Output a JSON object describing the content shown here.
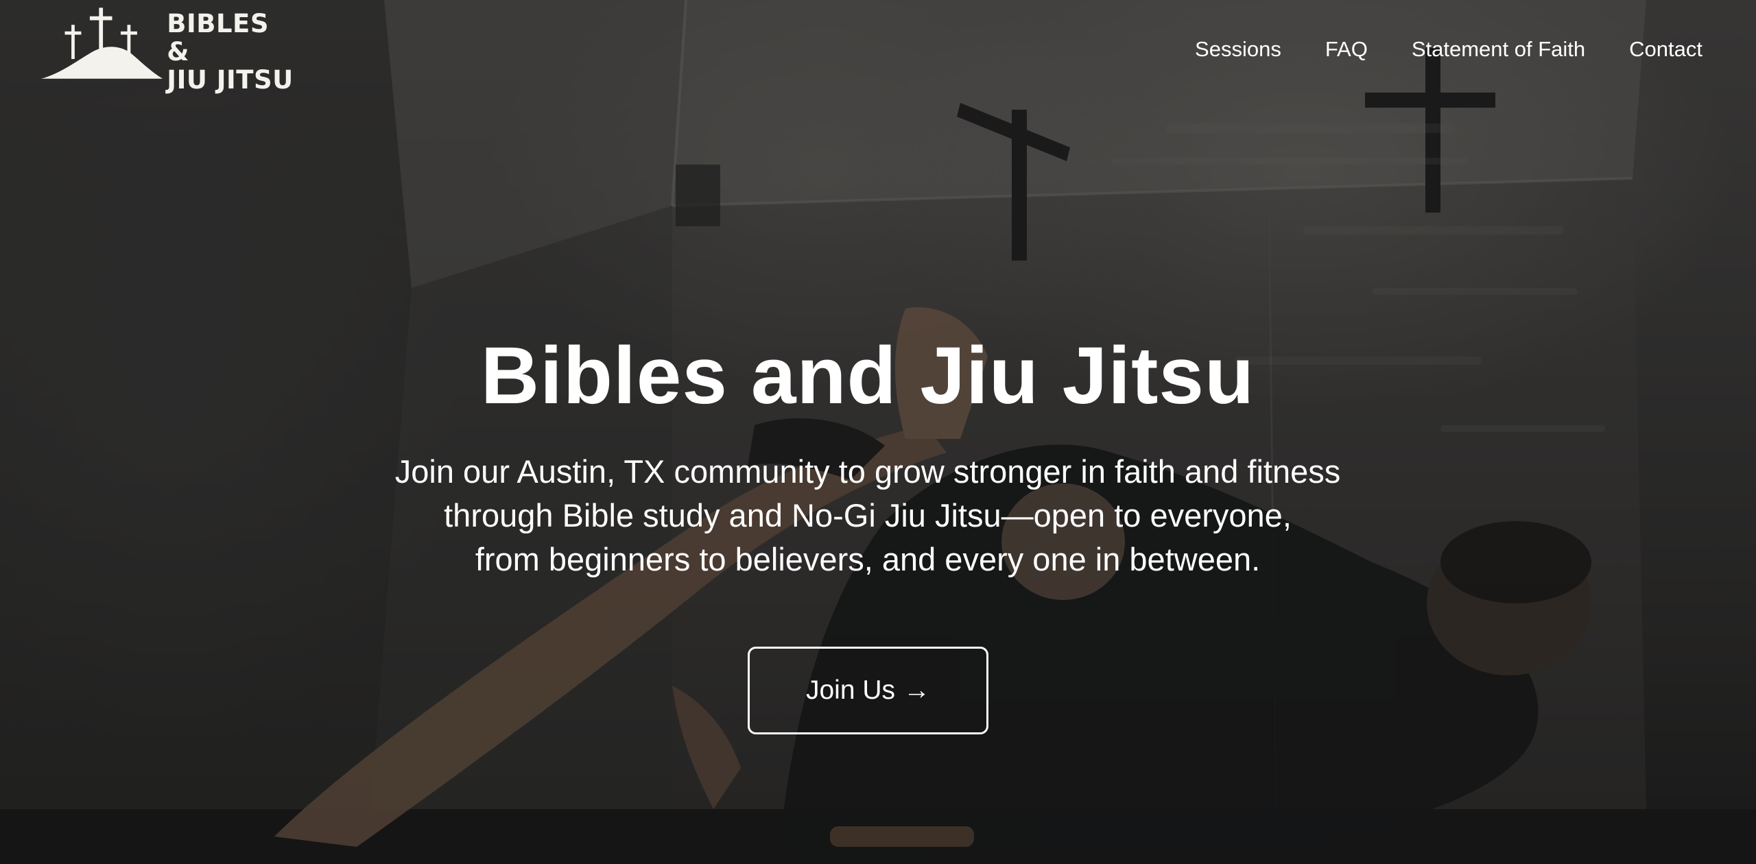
{
  "brand": {
    "name_line1": "BIBLES &",
    "name_line2": "JIU JITSU",
    "logo_icon": "three-crosses-hill-icon"
  },
  "nav": {
    "items": [
      {
        "label": "Sessions"
      },
      {
        "label": "FAQ"
      },
      {
        "label": "Statement of Faith"
      },
      {
        "label": "Contact"
      }
    ]
  },
  "hero": {
    "title": "Bibles and Jiu Jitsu",
    "subtitle_lines": [
      "Join our Austin, TX community to grow stronger in faith and fitness",
      "through Bible study and No-Gi Jiu Jitsu—open to everyone,",
      "from beginners to believers, and every one in between."
    ],
    "cta_label": "Join Us",
    "cta_arrow": "→",
    "background_image": "two-athletes-grappling-on-gym-mat"
  },
  "colors": {
    "text": "#ffffff",
    "logo": "#f4f2ec",
    "overlay": "#141414"
  }
}
